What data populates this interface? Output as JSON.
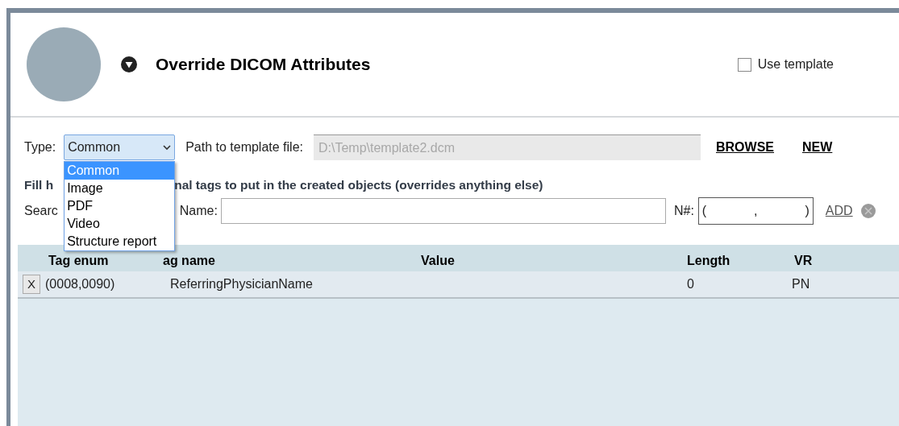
{
  "header": {
    "title": "Override DICOM Attributes",
    "use_template": {
      "label": "Use template",
      "checked": false
    }
  },
  "type_row": {
    "type_label": "Type:",
    "type_value": "Common",
    "path_label": "Path to template file:",
    "path_value": "D:\\Temp\\template2.dcm",
    "links": [
      "BROWSE",
      "NEW"
    ]
  },
  "dropdown": {
    "options": [
      {
        "label": "Common",
        "selected": true
      },
      {
        "label": "Image",
        "selected": false
      },
      {
        "label": "PDF",
        "selected": false
      },
      {
        "label": "Video",
        "selected": false
      },
      {
        "label": "Structure report",
        "selected": false
      }
    ]
  },
  "hint": {
    "left": "Fill h",
    "right": "nal tags to put in the created objects (overrides anything else)"
  },
  "search_row": {
    "search_label": "Searc",
    "name_label": "Name:",
    "number_label": "N#:",
    "number_parts": [
      "(",
      ",",
      ")"
    ],
    "add": "ADD"
  },
  "table": {
    "columns": [
      "Tag enum",
      "ag name",
      "Value",
      "Length",
      "VR"
    ],
    "rows": [
      {
        "remove": "X",
        "cells": [
          "(0008,0090)",
          "ReferringPhysicianName",
          "",
          "0",
          "PN"
        ]
      }
    ]
  }
}
